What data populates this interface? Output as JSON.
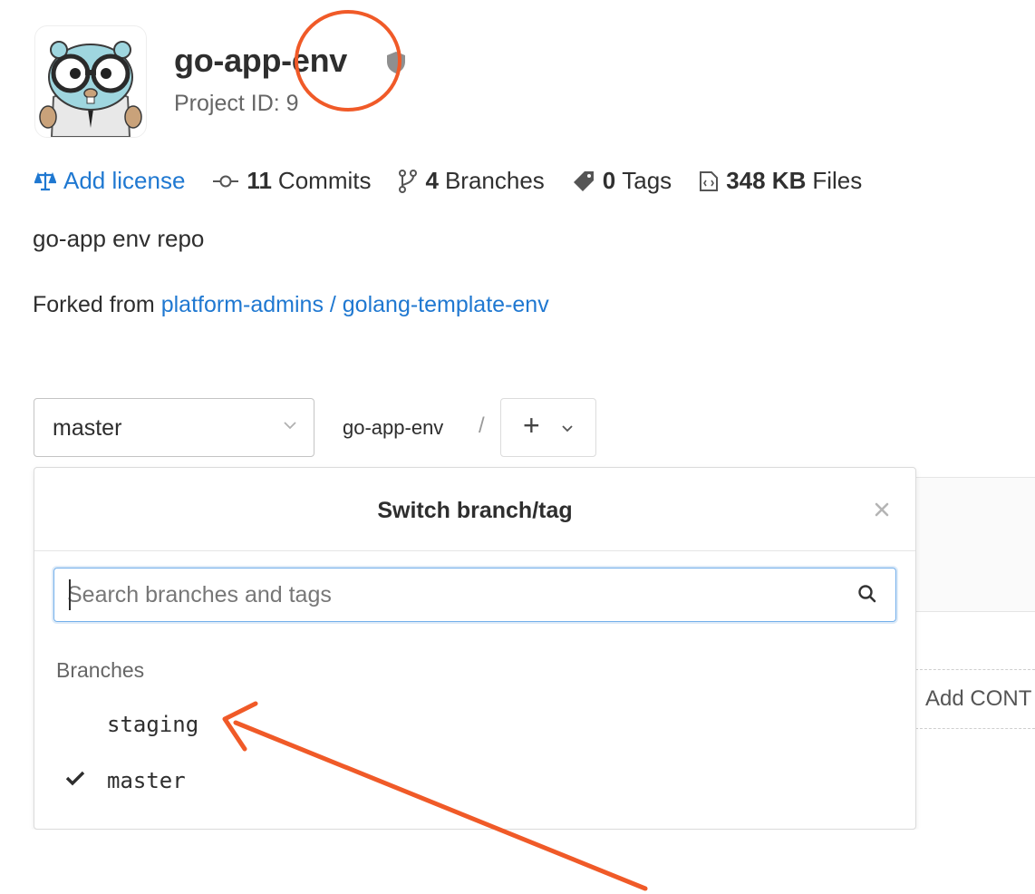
{
  "project": {
    "name": "go-app-env",
    "id_text": "Project ID: 9",
    "description": "go-app env repo",
    "forked_from_label": "Forked from",
    "forked_from_link": "platform-admins / golang-template-env"
  },
  "stats": {
    "license_link": "Add license",
    "commits_count": "11",
    "commits_label": "Commits",
    "branches_count": "4",
    "branches_label": "Branches",
    "tags_count": "0",
    "tags_label": "Tags",
    "files_size": "348 KB",
    "files_label": "Files"
  },
  "toolbar": {
    "branch_selected": "master",
    "path_root": "go-app-env",
    "path_separator": "/",
    "add_label": "+"
  },
  "dropdown": {
    "title": "Switch branch/tag",
    "search_placeholder": "Search branches and tags",
    "section_label": "Branches",
    "branches": [
      {
        "name": "staging",
        "selected": false
      },
      {
        "name": "master",
        "selected": true
      }
    ]
  },
  "background": {
    "add_contributing_partial": "Add CONT"
  },
  "colors": {
    "link": "#1f78d1",
    "annotation": "#f05a28"
  },
  "icons": {
    "license": "scale-icon",
    "commits": "commit-icon",
    "branches": "branch-icon",
    "tags": "tag-icon",
    "files": "file-icon",
    "visibility": "shield-icon"
  }
}
